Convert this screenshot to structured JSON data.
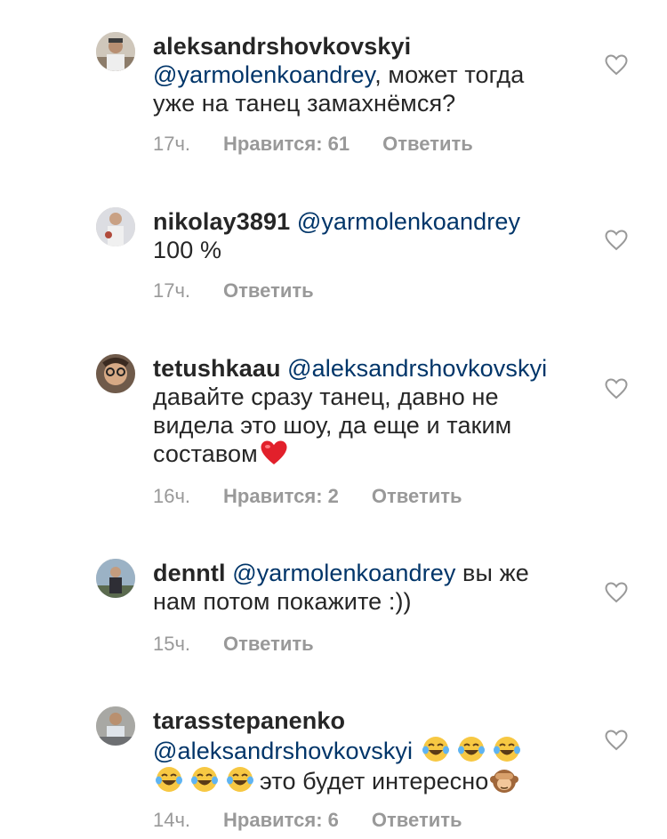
{
  "comments": [
    {
      "username": "aleksandrshovkovskyi",
      "mention": "@yarmolenkoandrey",
      "text_parts": [
        ", может тогда",
        "уже на танец замахнёмся?"
      ],
      "time": "17ч.",
      "likes": "Нравится: 61",
      "reply": "Ответить"
    },
    {
      "username": "nikolay3891",
      "mention": "@yarmolenkoandrey",
      "text_parts": [
        "100 %"
      ],
      "time": "17ч.",
      "reply": "Ответить"
    },
    {
      "username": "tetushkaau",
      "mention": "@aleksandrshovkovskyi",
      "text_parts": [
        "давайте сразу танец, давно не",
        "видела это шоу, да еще и таким",
        "составом"
      ],
      "time": "16ч.",
      "likes": "Нравится: 2",
      "reply": "Ответить",
      "emoji": "red-heart"
    },
    {
      "username": "denntl",
      "mention": "@yarmolenkoandrey",
      "text_parts": [
        " вы же",
        "нам потом покажите :))"
      ],
      "time": "15ч.",
      "reply": "Ответить"
    },
    {
      "username": "tarasstepanenko",
      "mention": "@aleksandrshovkovskyi",
      "text_parts": [
        "это будет интересно"
      ],
      "time": "14ч.",
      "likes": "Нравится: 6",
      "reply": "Ответить",
      "emoji": "tears-of-joy x6, see-no-evil-monkey"
    }
  ],
  "colors": {
    "text": "#262626",
    "mention": "#003569",
    "meta": "#999999",
    "heart_outline": "#999999"
  },
  "icons": {
    "like": "heart-outline-icon"
  }
}
